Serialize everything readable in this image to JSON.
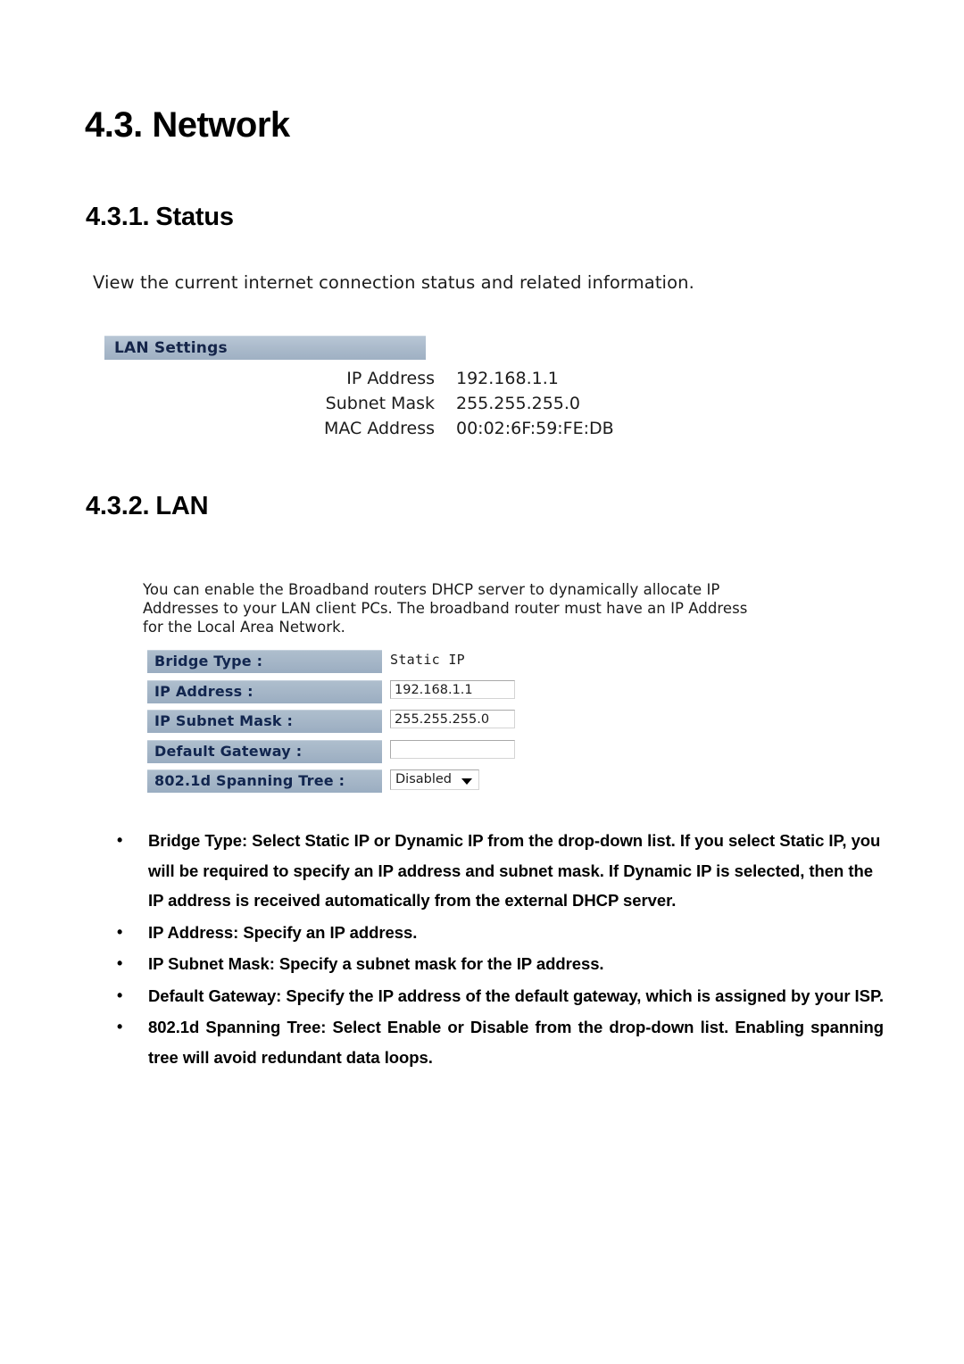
{
  "document": {
    "section_title": "4.3. Network",
    "section_number": "4.3.",
    "section_name": "Network"
  },
  "status_section": {
    "number": "4.3.1.",
    "title": "Status",
    "screenshot": {
      "caption": "View the current internet connection status and related information.",
      "panel_title": "LAN Settings",
      "rows": [
        {
          "label": "IP Address",
          "value": "192.168.1.1"
        },
        {
          "label": "Subnet Mask",
          "value": "255.255.255.0"
        },
        {
          "label": "MAC Address",
          "value": "00:02:6F:59:FE:DB"
        }
      ]
    }
  },
  "lan_section": {
    "number": "4.3.2.",
    "title": "LAN",
    "screenshot": {
      "description": "You can enable the Broadband routers DHCP server to dynamically allocate IP Addresses to your LAN client PCs. The broadband router must have an IP Address for the Local Area Network.",
      "fields": [
        {
          "label": "Bridge Type :",
          "value": "Static IP",
          "control": "text"
        },
        {
          "label": "IP Address :",
          "value": "192.168.1.1",
          "control": "input"
        },
        {
          "label": "IP Subnet Mask :",
          "value": "255.255.255.0",
          "control": "input"
        },
        {
          "label": "Default Gateway :",
          "value": "",
          "control": "input"
        },
        {
          "label": "802.1d Spanning Tree :",
          "value": "Disabled",
          "control": "select"
        }
      ]
    },
    "bullets": [
      "Bridge Type: Select Static IP or Dynamic IP from the drop-down list. If you select Static IP, you will be required to specify an IP address and subnet mask. If Dynamic IP is selected, then the IP address is received automatically from the external DHCP server.",
      "IP Address: Specify an IP address.",
      "IP Subnet Mask: Specify a subnet mask for the IP address.",
      "Default Gateway: Specify the IP address of the default gateway, which is assigned by your ISP.",
      "802.1d Spanning Tree: Select Enable or Disable from the drop-down list. Enabling spanning tree will avoid redundant data loops."
    ],
    "bullet_marker": "•"
  },
  "colors": {
    "panel_header_bg": "#a9b9ca",
    "field_label_bg": "#a3b4c6",
    "label_text": "#12264f",
    "page_bg": "#ffffff"
  }
}
